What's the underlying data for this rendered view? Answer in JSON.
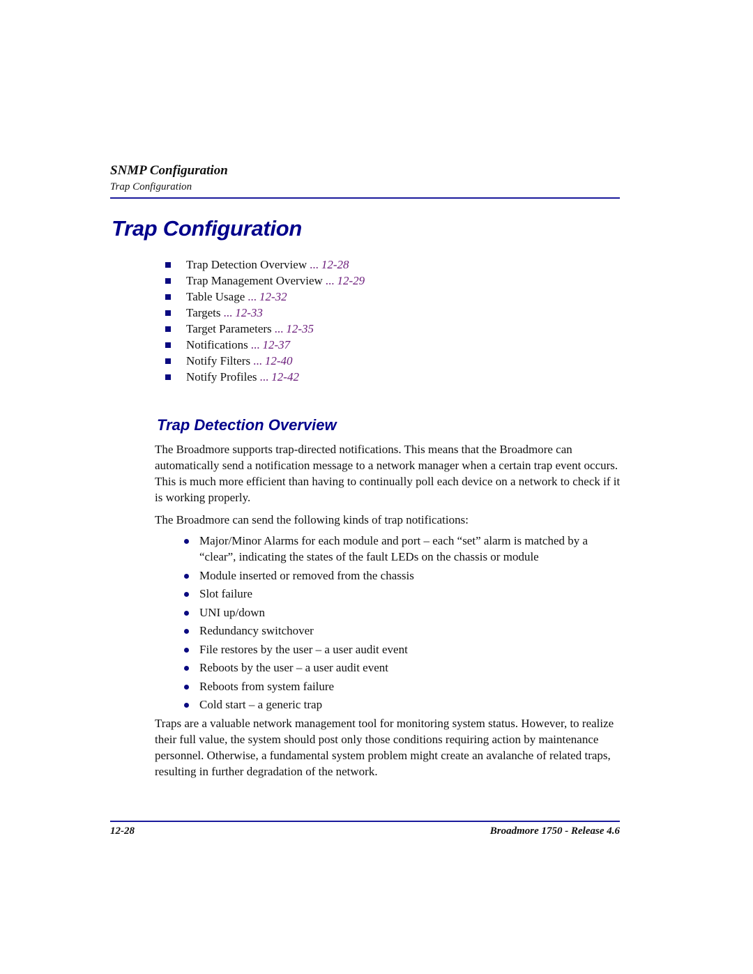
{
  "header": {
    "chapter": "SNMP Configuration",
    "section": "Trap Configuration"
  },
  "page_title": "Trap Configuration",
  "toc": [
    {
      "label": "Trap Detection Overview",
      "dots": "...",
      "page": "12-28"
    },
    {
      "label": "Trap Management Overview",
      "dots": "...",
      "page": "12-29"
    },
    {
      "label": "Table Usage",
      "dots": "...",
      "page": "12-32"
    },
    {
      "label": "Targets",
      "dots": "...",
      "page": "12-33"
    },
    {
      "label": "Target Parameters",
      "dots": "...",
      "page": "12-35"
    },
    {
      "label": "Notifications",
      "dots": "...",
      "page": "12-37"
    },
    {
      "label": "Notify Filters",
      "dots": "...",
      "page": "12-40"
    },
    {
      "label": "Notify Profiles",
      "dots": "...",
      "page": "12-42"
    }
  ],
  "section": {
    "heading": "Trap Detection Overview",
    "intro": "The Broadmore supports trap-directed notifications. This means that the Broadmore can automatically send a notification message to a network manager when a certain trap event occurs. This is much more efficient than having to continually poll each device on a network to check if it is working properly.",
    "lead": "The Broadmore can send the following kinds of trap notifications:",
    "bullets": [
      "Major/Minor Alarms for each module and port – each “set” alarm is matched by a “clear”, indicating the states of the fault LEDs on the chassis or module",
      "Module inserted or removed from the chassis",
      "Slot failure",
      "UNI up/down",
      "Redundancy switchover",
      "File restores by the user – a user audit event",
      "Reboots by the user – a user audit event",
      "Reboots from system failure",
      "Cold start – a generic trap"
    ],
    "closing": "Traps are a valuable network management tool for monitoring system status. However, to realize their full value, the system should post only those conditions requiring action by maintenance personnel. Otherwise, a fundamental system problem might create an avalanche of related traps, resulting in further degradation of the network."
  },
  "footer": {
    "page_number": "12-28",
    "product": "Broadmore 1750 - Release 4.6"
  },
  "colors": {
    "heading": "#00008b",
    "rule": "#1a1a9c",
    "link": "#6a1b7a",
    "bullet": "#0a0a80"
  }
}
